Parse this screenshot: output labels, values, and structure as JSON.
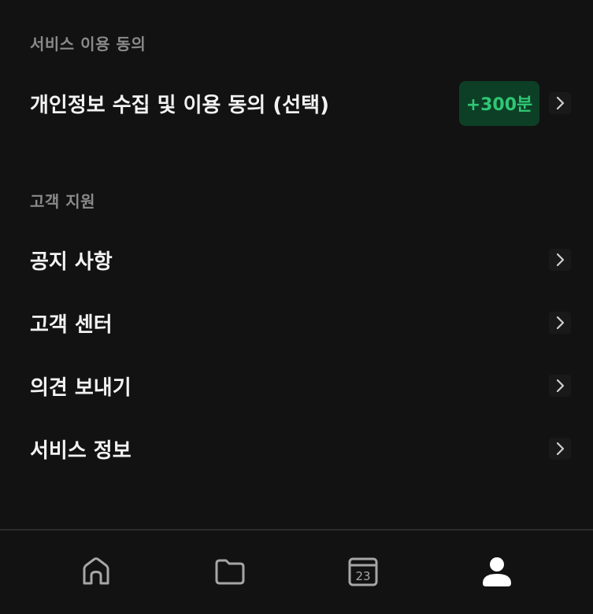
{
  "sections": {
    "consent_header": "서비스 이용 동의",
    "support_header": "고객 지원"
  },
  "consent_items": [
    {
      "label": "개인정보 수집 및 이용 동의 (선택)",
      "badge": "+300분"
    }
  ],
  "support_items": [
    {
      "label": "공지 사항"
    },
    {
      "label": "고객 센터"
    },
    {
      "label": "의견 보내기"
    },
    {
      "label": "서비스 정보"
    }
  ],
  "bottom_nav": {
    "items": [
      {
        "icon": "home-icon"
      },
      {
        "icon": "folder-icon"
      },
      {
        "icon": "calendar-icon",
        "date": "23"
      },
      {
        "icon": "profile-icon",
        "active": true
      }
    ]
  },
  "colors": {
    "background": "#121212",
    "badge_bg": "#0d3f26",
    "badge_text": "#2fc774",
    "muted": "#8a8a8a",
    "icon_inactive": "#a6a6a6",
    "icon_active": "#ffffff"
  }
}
